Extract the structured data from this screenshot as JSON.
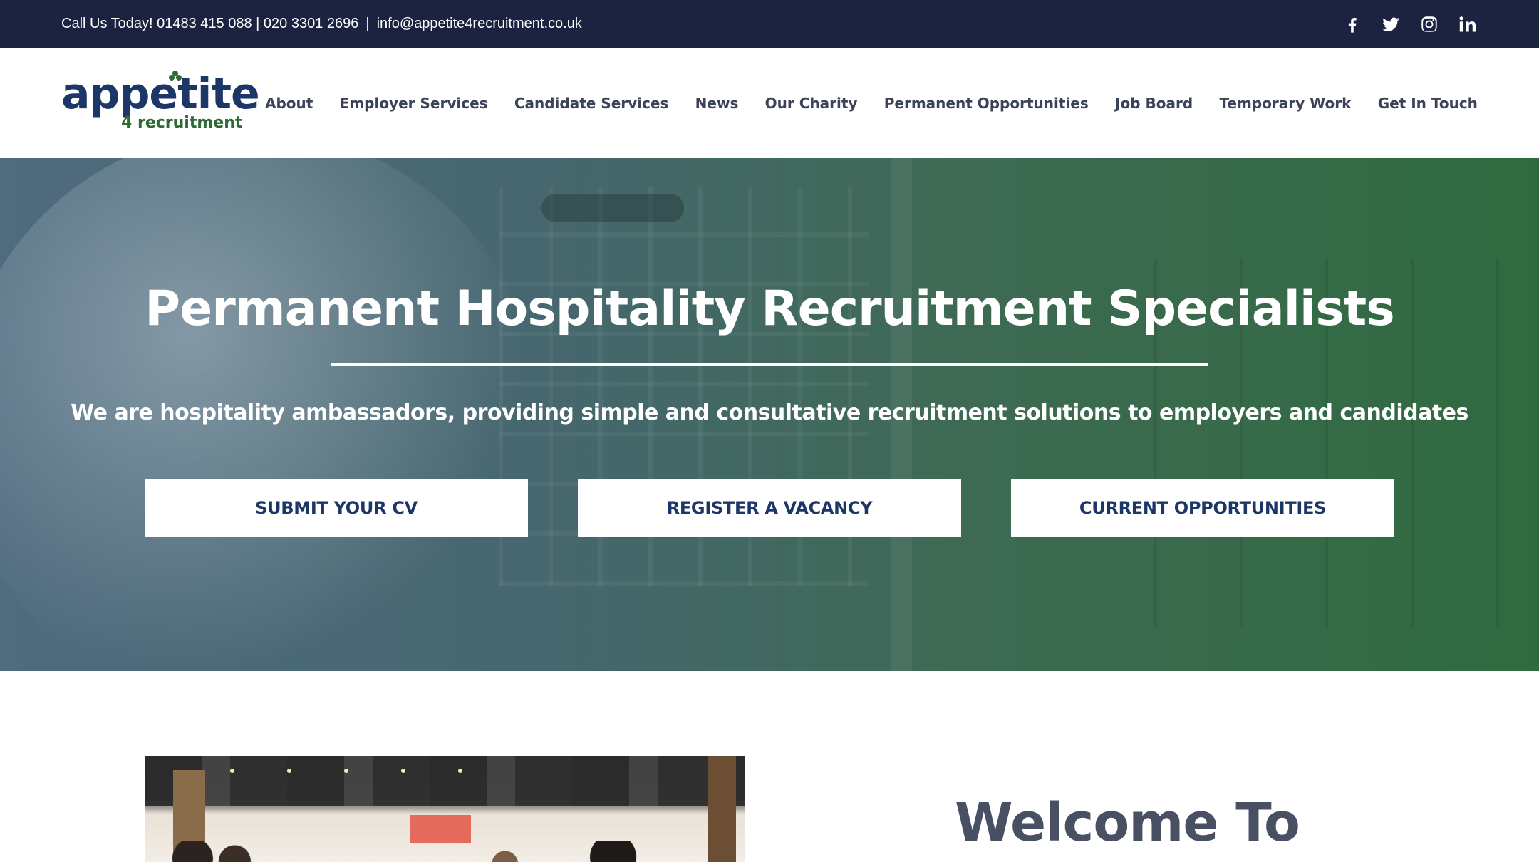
{
  "topbar": {
    "contact_phones": "Call Us Today! 01483 415 088 | 020 3301 2696",
    "separator": "|",
    "email": "info@appetite4recruitment.co.uk",
    "social": [
      {
        "icon": "facebook-icon"
      },
      {
        "icon": "twitter-icon"
      },
      {
        "icon": "instagram-icon"
      },
      {
        "icon": "linkedin-icon"
      }
    ]
  },
  "logo": {
    "word": "appetite",
    "sub": "4 recruitment"
  },
  "nav": {
    "items": [
      "About",
      "Employer Services",
      "Candidate Services",
      "News",
      "Our Charity",
      "Permanent Opportunities",
      "Job Board",
      "Temporary Work",
      "Get In Touch"
    ]
  },
  "hero": {
    "title": "Permanent Hospitality Recruitment Specialists",
    "tagline": "We are hospitality ambassadors, providing simple and consultative recruitment solutions to employers and candidates",
    "cta": [
      "SUBMIT YOUR CV",
      "REGISTER A VACANCY",
      "CURRENT OPPORTUNITIES"
    ]
  },
  "welcome": {
    "title": "Welcome To"
  },
  "colors": {
    "topbar_bg": "#1c2340",
    "brand_navy": "#1c3668",
    "brand_green": "#2d6b34",
    "nav_text": "#3c4358"
  }
}
